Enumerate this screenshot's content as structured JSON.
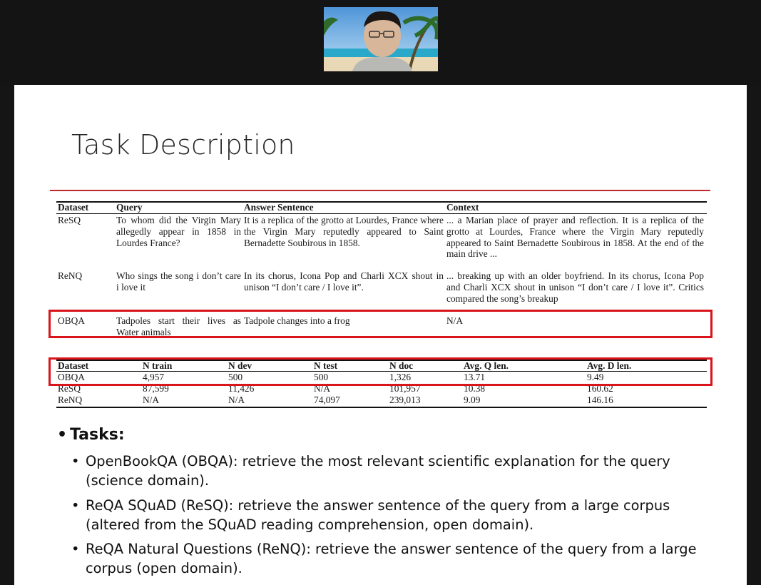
{
  "slide": {
    "title": "Task Description"
  },
  "examples_table": {
    "headers": [
      "Dataset",
      "Query",
      "Answer Sentence",
      "Context"
    ],
    "rows": [
      {
        "dataset": "ReSQ",
        "query": "To whom did the Virgin Mary allegedly appear in 1858 in Lourdes France?",
        "answer": "It is a replica of the grotto at Lourdes, France where the Virgin Mary reputedly appeared to Saint Bernadette Soubirous in 1858.",
        "context": "... a Marian place of prayer and reflection. It is a replica of the grotto at Lourdes, France where the Virgin Mary reputedly appeared to Saint Bernadette Soubirous in 1858. At the end of the main drive ..."
      },
      {
        "dataset": "ReNQ",
        "query": "Who sings the song i don’t care i love it",
        "answer": "In its chorus, Icona Pop and Charli XCX shout in unison “I don’t care / I love it”.",
        "context": "... breaking up with an older boyfriend. In its chorus, Icona Pop and Charli XCX shout in unison “I don’t care / I love it”. Critics compared the song’s breakup"
      },
      {
        "dataset": "OBQA",
        "query": "Tadpoles start their lives as Water animals",
        "answer": "Tadpole changes into a frog",
        "context": "N/A"
      }
    ]
  },
  "stats_table": {
    "headers": [
      "Dataset",
      "N train",
      "N dev",
      "N test",
      "N doc",
      "Avg. Q len.",
      "Avg. D len."
    ],
    "rows": [
      [
        "OBQA",
        "4,957",
        "500",
        "500",
        "1,326",
        "13.71",
        "9.49"
      ],
      [
        "ReSQ",
        "87,599",
        "11,426",
        "N/A",
        "101,957",
        "10.38",
        "160.62"
      ],
      [
        "ReNQ",
        "N/A",
        "N/A",
        "74,097",
        "239,013",
        "9.09",
        "146.16"
      ]
    ]
  },
  "tasks": {
    "heading": "Tasks:",
    "items": [
      "OpenBookQA (OBQA): retrieve the most relevant scientific explanation for the query (science domain).",
      "ReQA SQuAD (ReSQ): retrieve the answer sentence of the query from a large corpus (altered from the SQuAD reading comprehension, open domain).",
      "ReQA Natural Questions (ReNQ): retrieve the answer sentence of the query from a large corpus (open domain)."
    ]
  },
  "colors": {
    "highlight": "#d9141b",
    "title_rule": "#c0262c",
    "background": "#141414"
  }
}
